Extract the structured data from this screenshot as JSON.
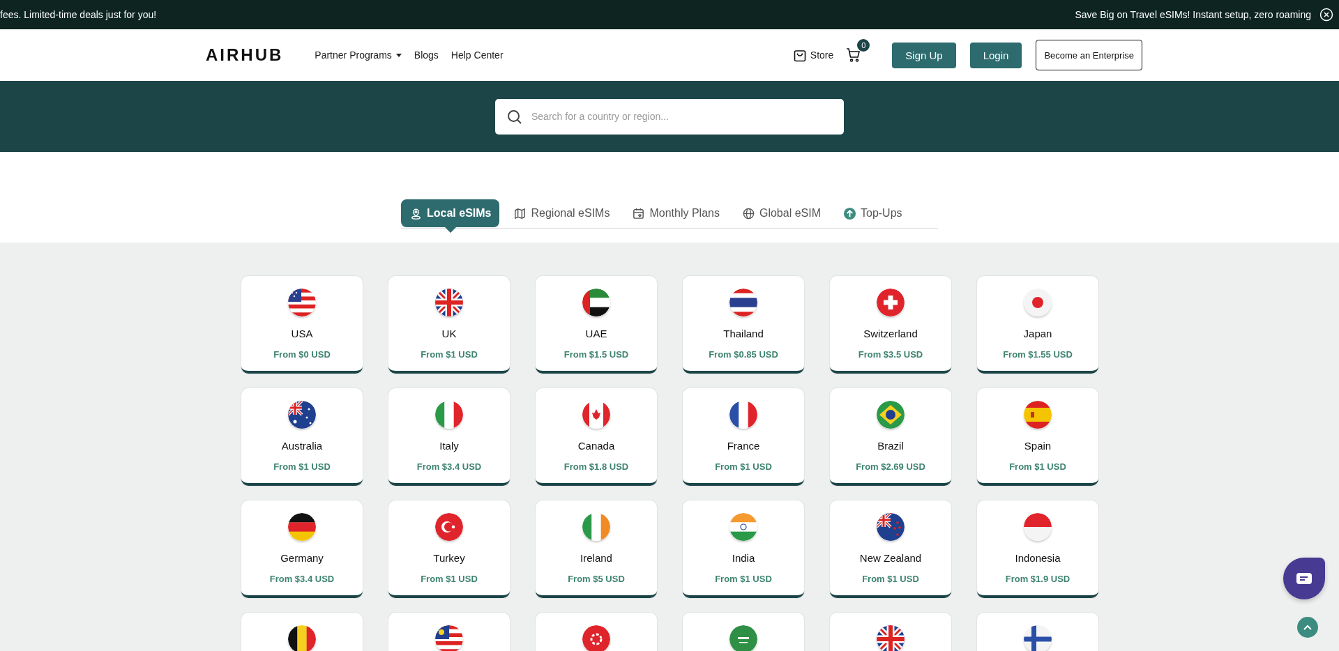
{
  "promo_bar": {
    "left_text": "fees. Limited-time deals just for you!",
    "right_text": "Save Big on Travel eSIMs! Instant setup, zero roaming"
  },
  "header": {
    "logo": "AIRHUB",
    "nav": [
      {
        "label": "Partner Programs",
        "dropdown": true
      },
      {
        "label": "Blogs",
        "dropdown": false
      },
      {
        "label": "Help Center",
        "dropdown": false
      }
    ],
    "store": "Store",
    "cart_count": "0",
    "buttons": [
      {
        "label": "Sign Up",
        "kind": "filled"
      },
      {
        "label": "Login",
        "kind": "filled"
      },
      {
        "label": "Become an Enterprise",
        "kind": "outline"
      }
    ]
  },
  "search": {
    "placeholder": "Search for a country or region..."
  },
  "tabs": [
    {
      "label": "Local eSIMs",
      "kind": "pin",
      "selected": true
    },
    {
      "label": "Regional eSIMs",
      "kind": "map",
      "selected": false
    },
    {
      "label": "Monthly Plans",
      "kind": "calendar",
      "selected": false
    },
    {
      "label": "Global eSIM",
      "kind": "globe",
      "selected": false
    },
    {
      "label": "Top-Ups",
      "kind": "up",
      "selected": false
    }
  ],
  "countries": [
    {
      "kind": "us",
      "name": "USA",
      "price": "From $0 USD"
    },
    {
      "kind": "gb",
      "name": "UK",
      "price": "From $1 USD"
    },
    {
      "kind": "ae",
      "name": "UAE",
      "price": "From $1.5 USD"
    },
    {
      "kind": "th",
      "name": "Thailand",
      "price": "From $0.85 USD"
    },
    {
      "kind": "ch",
      "name": "Switzerland",
      "price": "From $3.5 USD"
    },
    {
      "kind": "jp",
      "name": "Japan",
      "price": "From $1.55 USD"
    },
    {
      "kind": "au",
      "name": "Australia",
      "price": "From $1 USD"
    },
    {
      "kind": "it",
      "name": "Italy",
      "price": "From $3.4 USD"
    },
    {
      "kind": "ca",
      "name": "Canada",
      "price": "From $1.8 USD"
    },
    {
      "kind": "fr",
      "name": "France",
      "price": "From $1 USD"
    },
    {
      "kind": "br",
      "name": "Brazil",
      "price": "From $2.69 USD"
    },
    {
      "kind": "es",
      "name": "Spain",
      "price": "From $1 USD"
    },
    {
      "kind": "de",
      "name": "Germany",
      "price": "From $3.4 USD"
    },
    {
      "kind": "tr",
      "name": "Turkey",
      "price": "From $1 USD"
    },
    {
      "kind": "ie",
      "name": "Ireland",
      "price": "From $5 USD"
    },
    {
      "kind": "in",
      "name": "India",
      "price": "From $1 USD"
    },
    {
      "kind": "nz",
      "name": "New Zealand",
      "price": "From $1 USD"
    },
    {
      "kind": "id",
      "name": "Indonesia",
      "price": "From $1.9 USD"
    },
    {
      "kind": "be"
    },
    {
      "kind": "my"
    },
    {
      "kind": "hk"
    },
    {
      "kind": "sa"
    },
    {
      "kind": "gb"
    },
    {
      "kind": "fi"
    }
  ]
}
